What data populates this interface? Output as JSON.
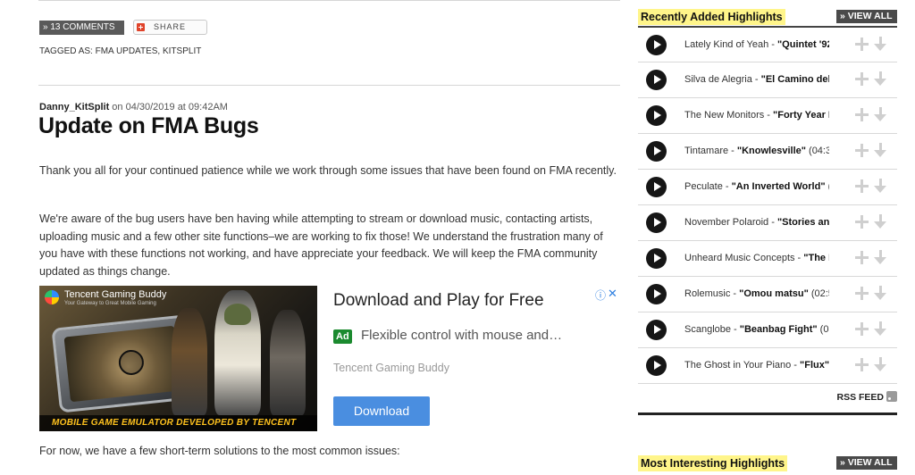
{
  "post_meta": {
    "comments_label": "» 13 COMMENTS",
    "share_label": "SHARE",
    "tagged_label": "TAGGED AS: FMA UPDATES, KITSPLIT"
  },
  "post": {
    "author": "Danny_KitSplit",
    "date_text": " on 04/30/2019 at 09:42AM",
    "title": "Update on FMA Bugs",
    "paragraphs": [
      "Thank you all for your continued patience while we work through some issues that have been found on FMA recently.",
      "We're aware of the bug users have ben having while attempting to stream or download music, contacting artists, uploading music and a few other site functions–we are working to fix those! We understand the frustration many of you have with these functions not working, and have appreciate your feedback. We will keep the FMA community updated as things change.",
      "For now, we have a few short-term solutions to the most common issues:"
    ]
  },
  "ad": {
    "image_brand": "Tencent Gaming Buddy",
    "image_tagline": "Your Gateway to Great Mobile Gaming",
    "image_banner": "MOBILE GAME EMULATOR DEVELOPED BY TENCENT",
    "headline": "Download and Play for Free",
    "badge": "Ad",
    "description": "Flexible control with mouse and…",
    "advertiser": "Tencent Gaming Buddy",
    "cta": "Download",
    "info_icon": "ⓘ",
    "close_icon": "✕"
  },
  "sidebar": {
    "recent": {
      "title": "Recently Added Highlights",
      "view_all": "» VIEW ALL",
      "tracks": [
        {
          "artist": "Lately Kind of Yeah - ",
          "song": "\"Quintet '92"
        },
        {
          "artist": "Silva de Alegria - ",
          "song": "\"El Camino del A"
        },
        {
          "artist": "The New Monitors - ",
          "song": "\"Forty Year E"
        },
        {
          "artist": "Tintamare - ",
          "song": "\"Knowlesville\"",
          "extra": " (04:32"
        },
        {
          "artist": "Peculate - ",
          "song": "\"An Inverted World\"",
          "extra": " (0"
        },
        {
          "artist": "November Polaroid - ",
          "song": "\"Stories and"
        },
        {
          "artist": "Unheard Music Concepts - ",
          "song": "\"The L"
        },
        {
          "artist": "Rolemusic - ",
          "song": "\"Omou matsu\"",
          "extra": " (02:50"
        },
        {
          "artist": "Scanglobe - ",
          "song": "\"Beanbag Fight\"",
          "extra": " (03:1"
        },
        {
          "artist": "The Ghost in Your Piano - ",
          "song": "\"Flux\"",
          "extra": " (0"
        }
      ],
      "rss_label": "RSS FEED"
    },
    "interesting": {
      "title": "Most Interesting Highlights",
      "view_all": "» VIEW ALL"
    }
  },
  "colors": {
    "highlight_yellow": "#fff58a",
    "ad_button_blue": "#4a8ee0",
    "ad_badge_green": "#1b8a2f",
    "banner_text": "#ffc21e"
  }
}
